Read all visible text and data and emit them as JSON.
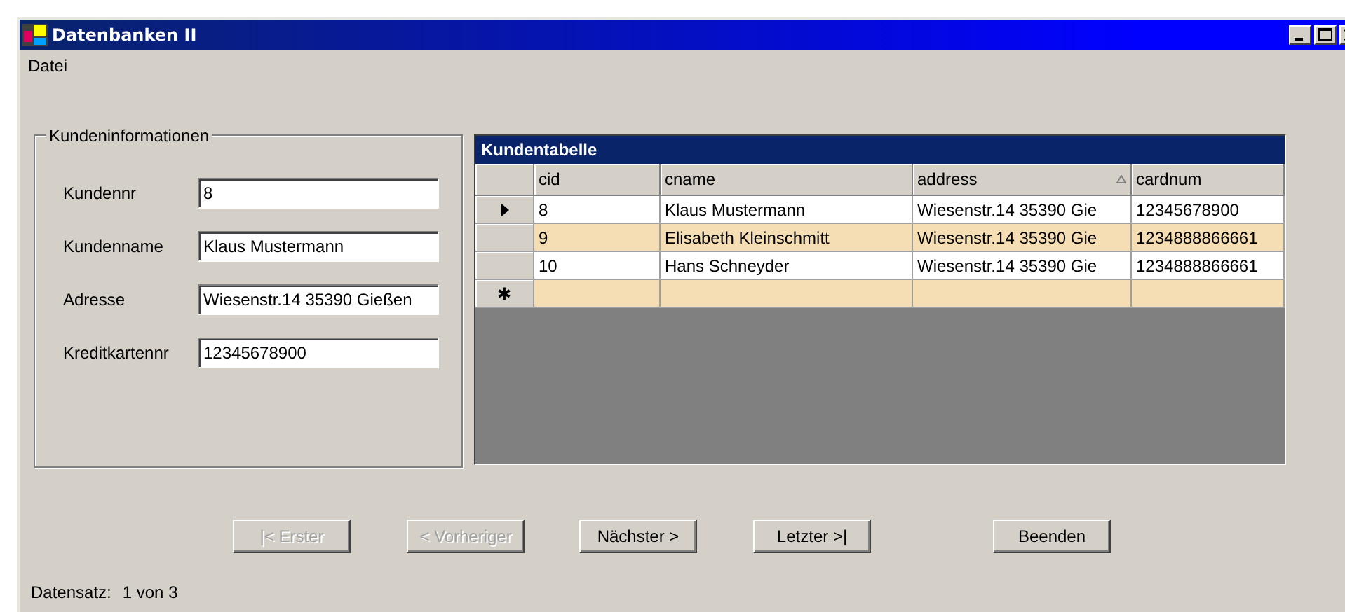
{
  "window": {
    "title": "Datenbanken II"
  },
  "menu": [
    "Datei"
  ],
  "group": {
    "title": "Kundeninformationen",
    "fields": [
      {
        "label": "Kundennr",
        "value": "8"
      },
      {
        "label": "Kundenname",
        "value": "Klaus Mustermann"
      },
      {
        "label": "Adresse",
        "value": "Wiesenstr.14 35390 Gießen"
      },
      {
        "label": "Kreditkartennr",
        "value": "12345678900"
      }
    ]
  },
  "table": {
    "caption": "Kundentabelle",
    "new_row_marker": "✱",
    "columns": [
      {
        "label": "cid",
        "sorted": false
      },
      {
        "label": "cname",
        "sorted": false
      },
      {
        "label": "address",
        "sorted": true
      },
      {
        "label": "cardnum",
        "sorted": false
      }
    ],
    "rows": [
      {
        "current": true,
        "cells": [
          "8",
          "Klaus Mustermann",
          "Wiesenstr.14 35390 Gie",
          "12345678900"
        ]
      },
      {
        "current": false,
        "cells": [
          "9",
          "Elisabeth Kleinschmitt",
          "Wiesenstr.14 35390 Gie",
          "1234888866661"
        ]
      },
      {
        "current": false,
        "cells": [
          "10",
          "Hans Schneyder",
          "Wiesenstr.14 35390 Gie",
          "1234888866661"
        ]
      }
    ]
  },
  "buttons": [
    {
      "label": "|< Erster",
      "disabled": true
    },
    {
      "label": "< Vorheriger",
      "disabled": true
    },
    {
      "label": "Nächster >",
      "disabled": false
    },
    {
      "label": "Letzter >|",
      "disabled": false
    },
    {
      "label": "Beenden",
      "disabled": false
    }
  ],
  "status_bar": {
    "label": "Datensatz:",
    "value": "1 von 3"
  }
}
